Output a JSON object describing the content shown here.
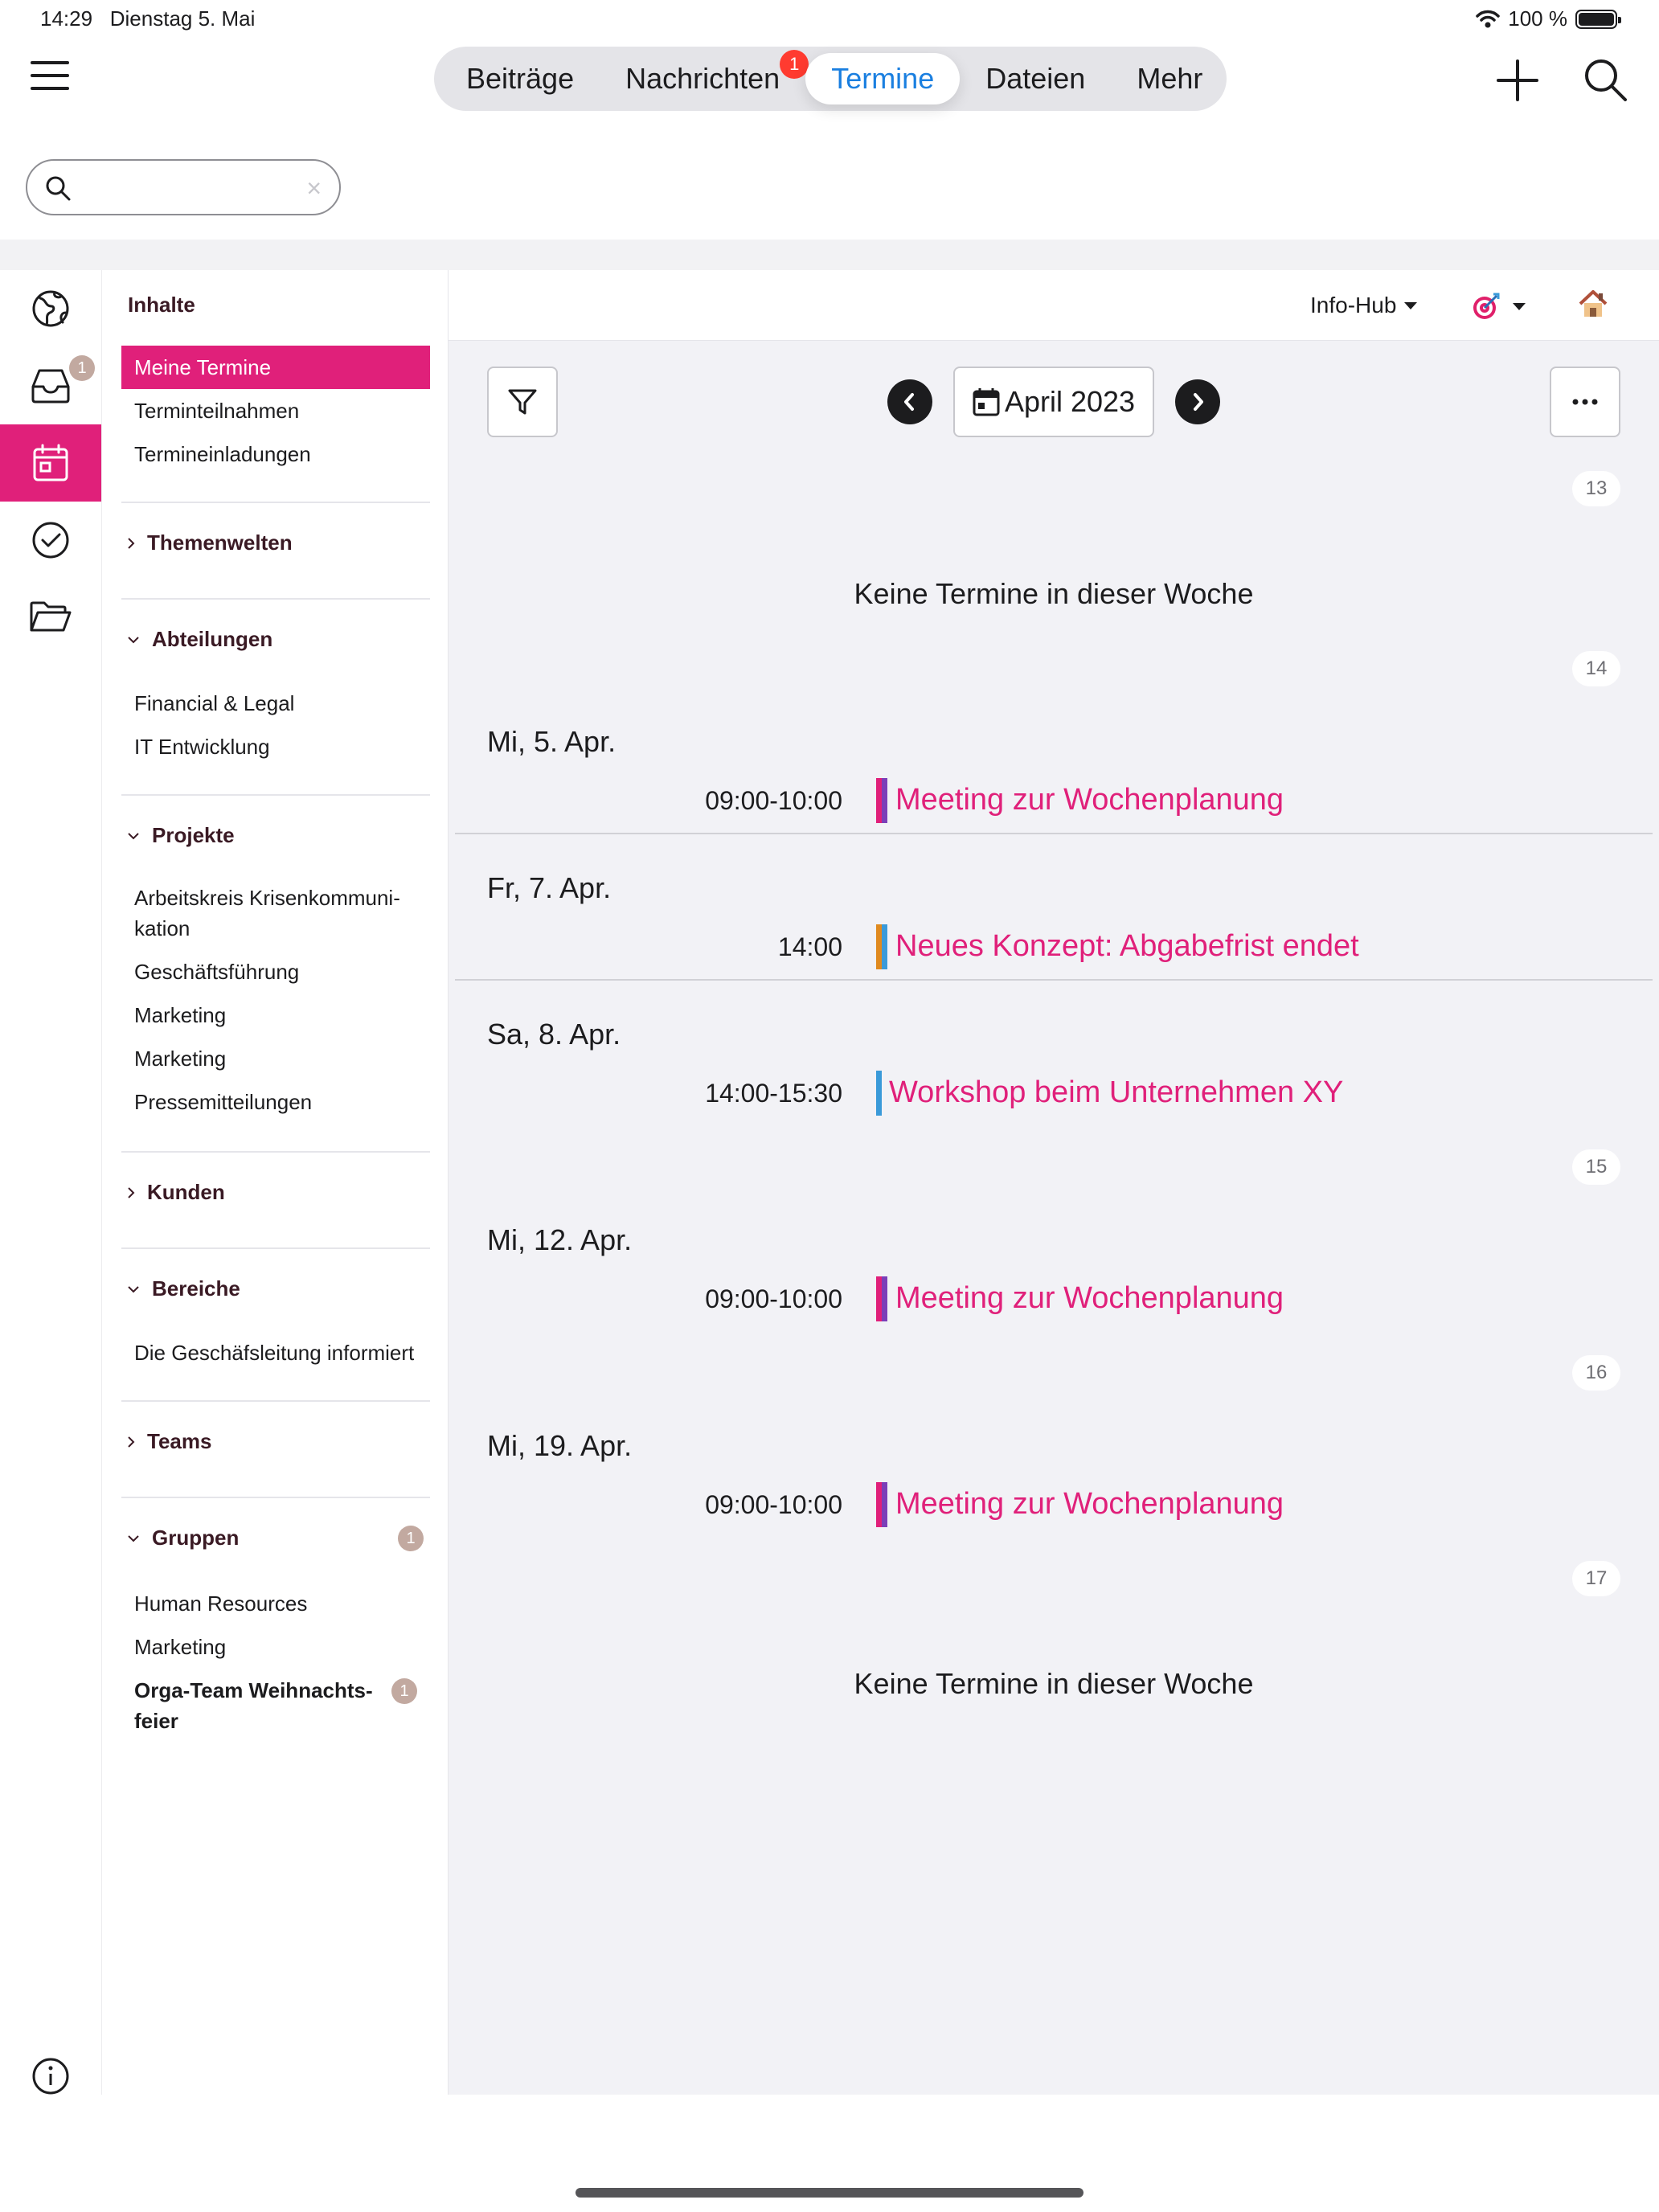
{
  "status": {
    "time": "14:29",
    "date": "Dienstag 5. Mai",
    "battery": "100 %"
  },
  "topnav": {
    "tabs": [
      {
        "label": "Beiträge"
      },
      {
        "label": "Nachrichten",
        "badge": "1"
      },
      {
        "label": "Termine"
      },
      {
        "label": "Dateien"
      },
      {
        "label": "Mehr"
      }
    ],
    "active_tab": "Termine",
    "accent": "#1a7fe0"
  },
  "search": {
    "value": "",
    "placeholder": ""
  },
  "rail": {
    "inbox_badge": "1",
    "active": "calendar",
    "accent": "#e0207a"
  },
  "sidebar": {
    "title": "Inhalte",
    "top_items": [
      "Meine Termine",
      "Terminteilnahmen",
      "Termineinladungen"
    ],
    "sections": {
      "themenwelten": "Themenwelten",
      "abteilungen": "Abteilungen",
      "projekte": "Projekte",
      "kunden": "Kunden",
      "bereiche": "Bereiche",
      "teams": "Teams",
      "gruppen": "Gruppen"
    },
    "abteilungen": [
      "Financial & Legal",
      "IT Entwicklung"
    ],
    "projekte": [
      "Arbeitskreis Krisenkommuni-",
      "kation",
      "Geschäftsführung",
      "Marketing",
      "Marketing",
      "Pressemitteilungen"
    ],
    "bereiche": [
      "Die Geschäfsleitung informiert"
    ],
    "gruppen": [
      "Human Resources",
      "Marketing",
      "Orga-Team Weihnachts-",
      "feier"
    ],
    "gruppen_badge": "1",
    "orga_badge": "1"
  },
  "main": {
    "info_hub": "Info-Hub",
    "month": "April 2023",
    "empty_text": "Keine Termine in dieser Woche",
    "weeks": [
      "13",
      "14",
      "15",
      "16",
      "17"
    ],
    "days": [
      {
        "date": "Mi, 5. Apr.",
        "time": "09:00-10:00",
        "title": "Meeting zur Wochenplanung",
        "colors": [
          "#e0207a",
          "#7b3fb8"
        ]
      },
      {
        "date": "Fr, 7. Apr.",
        "time": "14:00",
        "title": "Neues Konzept: Abgabefrist endet",
        "colors": [
          "#e08a1f",
          "#3a9ad9"
        ]
      },
      {
        "date": "Sa, 8. Apr.",
        "time": "14:00-15:30",
        "title": "Workshop beim Unternehmen XY",
        "colors": [
          "#3a9ad9"
        ]
      },
      {
        "date": "Mi, 12. Apr.",
        "time": "09:00-10:00",
        "title": "Meeting zur Wochenplanung",
        "colors": [
          "#e0207a",
          "#7b3fb8"
        ]
      },
      {
        "date": "Mi, 19. Apr.",
        "time": "09:00-10:00",
        "title": "Meeting zur Wochenplanung",
        "colors": [
          "#e0207a",
          "#7b3fb8"
        ]
      }
    ]
  }
}
